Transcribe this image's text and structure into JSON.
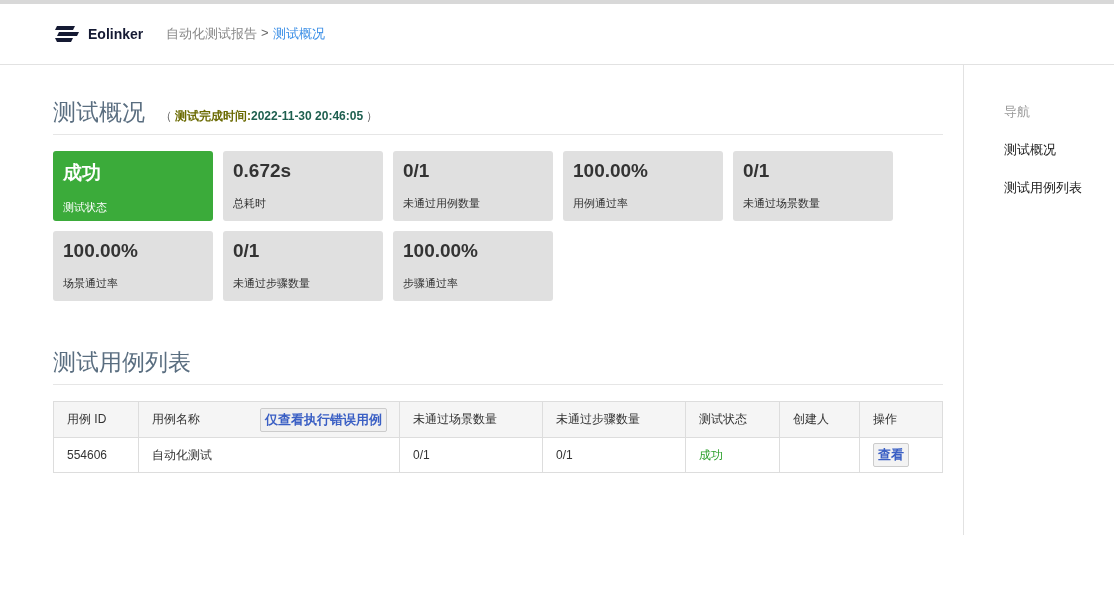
{
  "header": {
    "brand": "Eolinker",
    "breadcrumb": [
      {
        "label": "自动化测试报告",
        "current": false
      },
      {
        "label": "测试概况",
        "current": true
      }
    ],
    "separator": ">"
  },
  "overview": {
    "title": "测试概况",
    "note": {
      "open": "（",
      "label": "测试完成时间:",
      "value": "2022-11-30 20:46:05",
      "close": "）"
    },
    "stats": [
      {
        "value": "成功",
        "label": "测试状态",
        "kind": "success"
      },
      {
        "value": "0.672s",
        "label": "总耗时",
        "kind": "plain"
      },
      {
        "value": "0/1",
        "label": "未通过用例数量",
        "kind": "plain"
      },
      {
        "value": "100.00%",
        "label": "用例通过率",
        "kind": "plain"
      },
      {
        "value": "0/1",
        "label": "未通过场景数量",
        "kind": "plain"
      },
      {
        "value": "100.00%",
        "label": "场景通过率",
        "kind": "plain"
      },
      {
        "value": "0/1",
        "label": "未通过步骤数量",
        "kind": "plain"
      },
      {
        "value": "100.00%",
        "label": "步骤通过率",
        "kind": "plain"
      }
    ]
  },
  "cases": {
    "title": "测试用例列表",
    "filter_button": "仅查看执行错误用例",
    "columns": [
      "用例 ID",
      "用例名称",
      "未通过场景数量",
      "未通过步骤数量",
      "测试状态",
      "创建人",
      "操作"
    ],
    "rows": [
      {
        "id": "554606",
        "name": "自动化测试",
        "failed_scenarios": "0/1",
        "failed_steps": "0/1",
        "status": {
          "text": "成功",
          "kind": "success"
        },
        "action": "查看"
      }
    ]
  },
  "sidebar": {
    "title": "导航",
    "items": [
      "测试概况",
      "测试用例列表"
    ]
  }
}
